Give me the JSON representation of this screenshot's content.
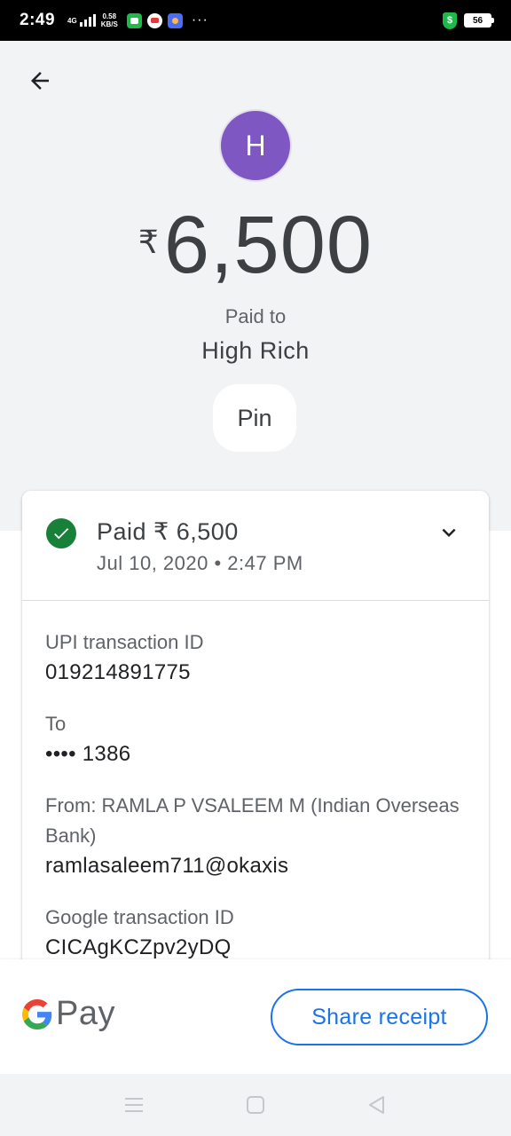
{
  "status_bar": {
    "time": "2:49",
    "network": "4G",
    "speed_value": "0.58",
    "speed_unit": "KB/S",
    "more": "···",
    "shield_symbol": "$",
    "battery": "56"
  },
  "header": {
    "avatar_initial": "H",
    "currency_symbol": "₹",
    "amount": "6,500",
    "paid_to_label": "Paid to",
    "payee_name": "High Rich",
    "pin_label": "Pin"
  },
  "card": {
    "status": "Paid ₹ 6,500",
    "date": "Jul 10, 2020 • 2:47 PM",
    "details": [
      {
        "label": "UPI transaction ID",
        "value": "019214891775"
      },
      {
        "label": "To",
        "value": "•••• 1386"
      },
      {
        "label": "From: RAMLA P VSALEEM M (Indian Overseas Bank)",
        "value": "ramlasaleem711@okaxis"
      },
      {
        "label": "Google transaction ID",
        "value": "CICAgKCZpv2yDQ"
      }
    ]
  },
  "bottom": {
    "brand_text": "Pay",
    "share_label": "Share receipt"
  },
  "colors": {
    "accent": "#1a73e8",
    "avatar": "#7e57c2",
    "success": "#188038",
    "header_bg": "#f1f3f4"
  },
  "icons": [
    "back-arrow-icon",
    "check-circle-icon",
    "chevron-down-icon",
    "google-g-icon",
    "nav-menu-icon",
    "nav-home-icon",
    "nav-back-icon"
  ]
}
